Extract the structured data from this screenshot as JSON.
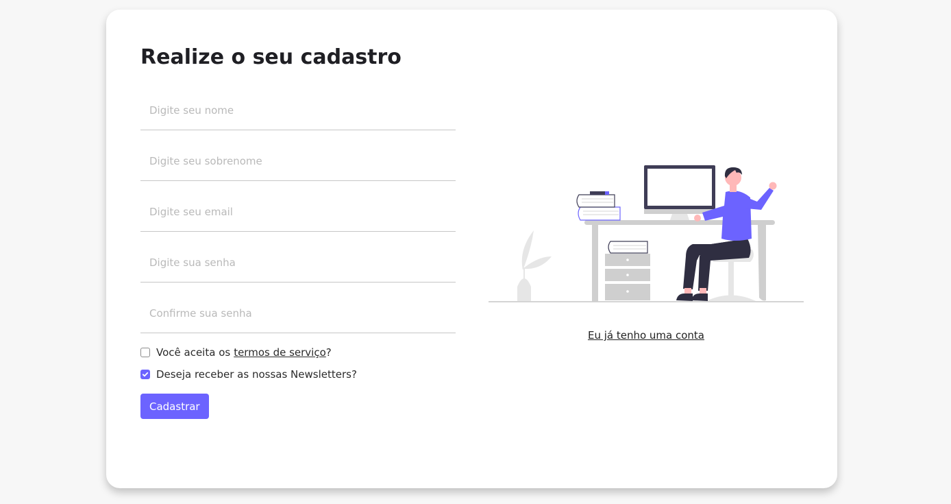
{
  "form": {
    "title": "Realize o seu cadastro",
    "fields": [
      {
        "placeholder": "Digite seu nome",
        "value": ""
      },
      {
        "placeholder": "Digite seu sobrenome",
        "value": ""
      },
      {
        "placeholder": "Digite seu email",
        "value": ""
      },
      {
        "placeholder": "Digite sua senha",
        "value": ""
      },
      {
        "placeholder": "Confirme sua senha",
        "value": ""
      }
    ],
    "terms": {
      "prefix": "Você aceita os",
      "link": "termos de serviço",
      "suffix": "?",
      "checked": false
    },
    "newsletter": {
      "label": "Deseja receber as nossas Newsletters?",
      "checked": true
    },
    "submit_label": "Cadastrar"
  },
  "side": {
    "illustration": "person-at-desk-illustration",
    "login_link": "Eu já tenho uma conta"
  },
  "colors": {
    "accent": "#6c63ff",
    "background": "#f7f7f7",
    "card": "#ffffff"
  }
}
